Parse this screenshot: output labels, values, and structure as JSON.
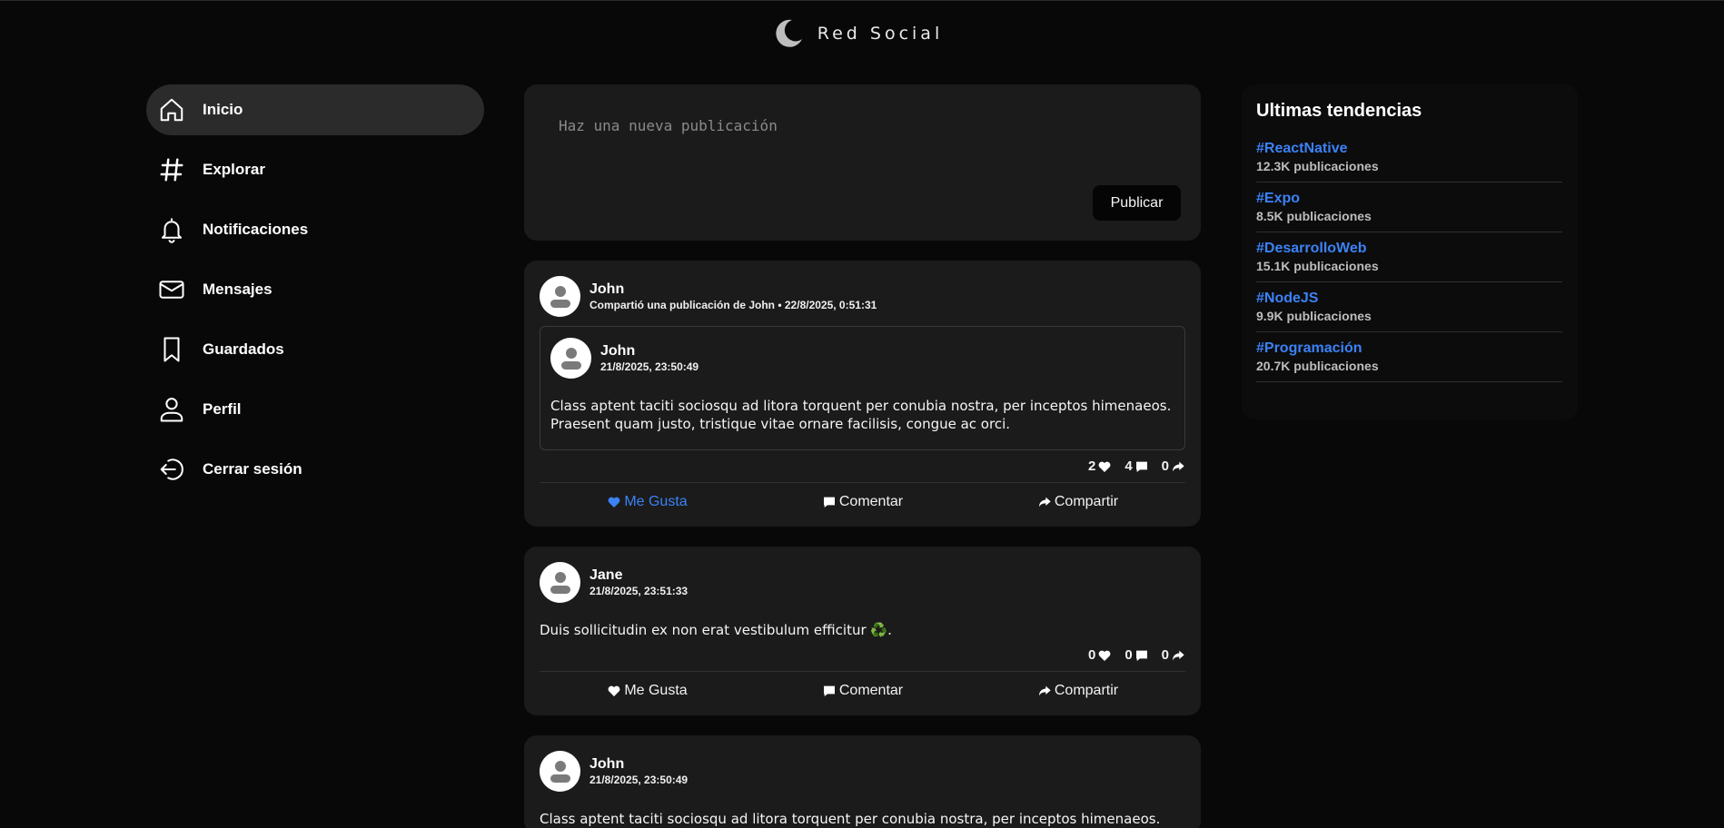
{
  "brand": {
    "title": "Red Social"
  },
  "sidebar": {
    "items": [
      {
        "label": "Inicio",
        "icon": "home-icon",
        "active": true
      },
      {
        "label": "Explorar",
        "icon": "hashtag-icon"
      },
      {
        "label": "Notificaciones",
        "icon": "bell-icon"
      },
      {
        "label": "Mensajes",
        "icon": "mail-icon"
      },
      {
        "label": "Guardados",
        "icon": "bookmark-icon"
      },
      {
        "label": "Perfil",
        "icon": "user-icon"
      },
      {
        "label": "Cerrar sesión",
        "icon": "logout-icon"
      }
    ]
  },
  "composer": {
    "placeholder": "Haz una nueva publicación",
    "publish_label": "Publicar"
  },
  "posts": [
    {
      "author": "John",
      "meta": "Compartió una publicación de John • 22/8/2025, 0:51:31",
      "shared": {
        "author": "John",
        "date": "21/8/2025, 23:50:49",
        "text": "Class aptent taciti sociosqu ad litora torquent per conubia nostra, per inceptos himenaeos. Praesent quam justo, tristique vitae ornare facilisis, congue ac orci."
      },
      "likes": "2",
      "comments": "4",
      "shares": "0",
      "like_label": "Me Gusta",
      "comment_label": "Comentar",
      "share_label": "Compartir"
    },
    {
      "author": "Jane",
      "meta": "21/8/2025, 23:51:33",
      "text": "Duis sollicitudin ex non erat vestibulum efficitur ♻️.",
      "likes": "0",
      "comments": "0",
      "shares": "0",
      "like_label": "Me Gusta",
      "comment_label": "Comentar",
      "share_label": "Compartir"
    },
    {
      "author": "John",
      "meta": "21/8/2025, 23:50:49",
      "text": "Class aptent taciti sociosqu ad litora torquent per conubia nostra, per inceptos himenaeos."
    }
  ],
  "trends": {
    "title": "Ultimas tendencias",
    "items": [
      {
        "tag": "#ReactNative",
        "count": "12.3K publicaciones"
      },
      {
        "tag": "#Expo",
        "count": "8.5K publicaciones"
      },
      {
        "tag": "#DesarrolloWeb",
        "count": "15.1K publicaciones"
      },
      {
        "tag": "#NodeJS",
        "count": "9.9K publicaciones"
      },
      {
        "tag": "#Programación",
        "count": "20.7K publicaciones"
      }
    ]
  },
  "colors": {
    "accent": "#3b82f6",
    "card": "#1b1b1b",
    "background": "#080808"
  }
}
